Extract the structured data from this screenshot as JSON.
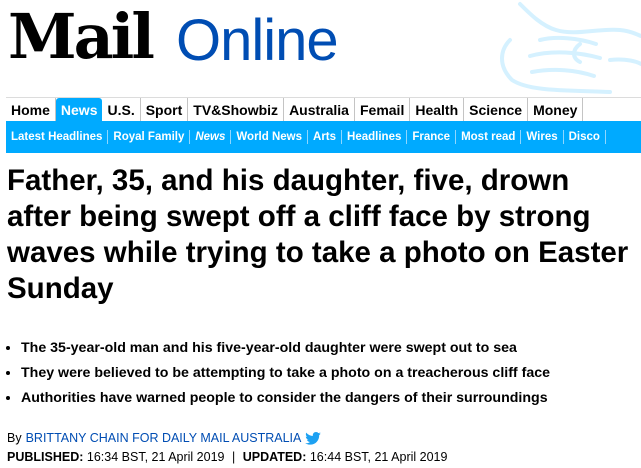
{
  "masthead": {
    "logo_mail": "Mail",
    "logo_online": "Online"
  },
  "nav": {
    "primary": [
      {
        "label": "Home",
        "active": false
      },
      {
        "label": "News",
        "active": true
      },
      {
        "label": "U.S.",
        "active": false
      },
      {
        "label": "Sport",
        "active": false
      },
      {
        "label": "TV&Showbiz",
        "active": false
      },
      {
        "label": "Australia",
        "active": false
      },
      {
        "label": "Femail",
        "active": false
      },
      {
        "label": "Health",
        "active": false
      },
      {
        "label": "Science",
        "active": false
      },
      {
        "label": "Money",
        "active": false
      }
    ],
    "secondary": [
      {
        "label": "Latest Headlines"
      },
      {
        "label": "Royal Family"
      },
      {
        "label": "News"
      },
      {
        "label": "World News"
      },
      {
        "label": "Arts"
      },
      {
        "label": "Headlines"
      },
      {
        "label": "France"
      },
      {
        "label": "Most read"
      },
      {
        "label": "Wires"
      },
      {
        "label": "Disco"
      }
    ]
  },
  "article": {
    "headline": "Father, 35, and his daughter, five, drown after being swept off a cliff face by strong waves while trying to take a photo on Easter Sunday",
    "bullets": [
      "The 35-year-old man and his five-year-old daughter were swept out to sea",
      "They were believed to be attempting to take a photo on a treacherous cliff face",
      "Authorities have warned people to consider the dangers of their surroundings"
    ],
    "byline_prefix": "By",
    "author": "BRITTANY CHAIN FOR DAILY MAIL AUSTRALIA",
    "published_label": "PUBLISHED:",
    "published": "16:34 BST, 21 April 2019",
    "separator": "|",
    "updated_label": "UPDATED:",
    "updated": "16:44 BST, 21 April 2019"
  },
  "icons": {
    "twitter": "twitter-icon",
    "decoration": "pointing-hand-icon"
  },
  "colors": {
    "brand_blue": "#00aaff",
    "online_blue": "#004db3",
    "author_blue": "#004db3"
  }
}
